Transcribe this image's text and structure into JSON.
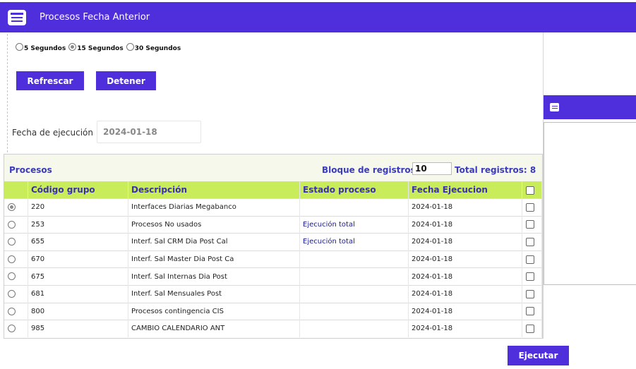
{
  "window": {
    "title": "Procesos Fecha Anterior",
    "icon": "window-icon"
  },
  "refresh": {
    "options": [
      {
        "label": "5 Segundos",
        "selected": false
      },
      {
        "label": "15 Segundos",
        "selected": true
      },
      {
        "label": "30 Segundos",
        "selected": false
      }
    ],
    "refresh_button": "Refrescar",
    "stop_button": "Detener"
  },
  "fecha": {
    "label": "Fecha de ejecución",
    "value": "2024-01-18"
  },
  "procesos": {
    "title": "Procesos",
    "bloque_label": "Bloque de registros:",
    "bloque_value": "10",
    "total_label": "Total registros: 8",
    "columns": [
      "Código grupo",
      "Descripción",
      "Estado proceso",
      "Fecha Ejecucion"
    ],
    "rows": [
      {
        "codigo": "220",
        "descripcion": "Interfaces Diarias Megabanco",
        "estado": "",
        "fecha": "2024-01-18",
        "selected": true
      },
      {
        "codigo": "253",
        "descripcion": "Procesos No usados",
        "estado": "Ejecución total",
        "fecha": "2024-01-18",
        "selected": false
      },
      {
        "codigo": "655",
        "descripcion": "Interf. Sal CRM Dia Post Cal",
        "estado": "Ejecución total",
        "fecha": "2024-01-18",
        "selected": false
      },
      {
        "codigo": "670",
        "descripcion": "Interf. Sal Master Dia Post Ca",
        "estado": "",
        "fecha": "2024-01-18",
        "selected": false
      },
      {
        "codigo": "675",
        "descripcion": "Interf. Sal Internas Dia Post",
        "estado": "",
        "fecha": "2024-01-18",
        "selected": false
      },
      {
        "codigo": "681",
        "descripcion": "Interf. Sal Mensuales Post",
        "estado": "",
        "fecha": "2024-01-18",
        "selected": false
      },
      {
        "codigo": "800",
        "descripcion": "Procesos contingencia CIS",
        "estado": "",
        "fecha": "2024-01-18",
        "selected": false
      },
      {
        "codigo": "985",
        "descripcion": "CAMBIO CALENDARIO ANT",
        "estado": "",
        "fecha": "2024-01-18",
        "selected": false
      }
    ]
  },
  "actions": {
    "execute_button": "Ejecutar"
  },
  "colors": {
    "accent": "#4f2fdc",
    "header_green": "#c8ec5a",
    "label_blue": "#3b3bbf"
  }
}
